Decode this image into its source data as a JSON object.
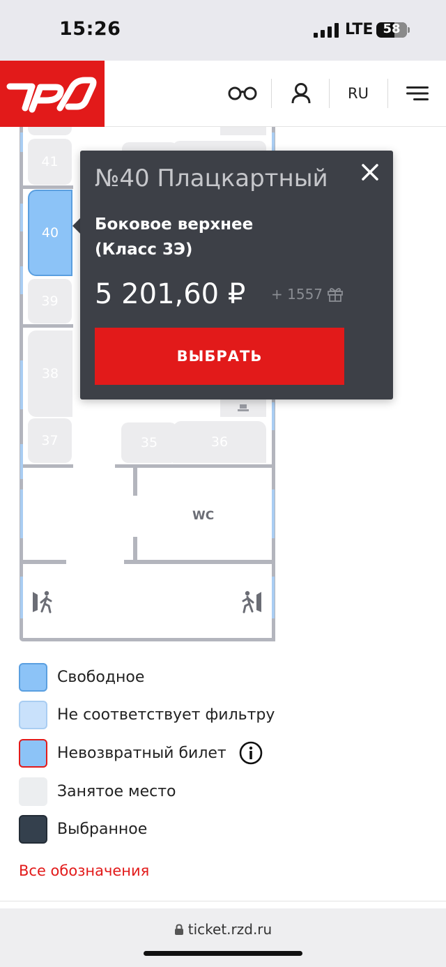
{
  "status_bar": {
    "time": "15:26",
    "network": "LTE",
    "battery": "58"
  },
  "header": {
    "logo": "РЖД",
    "language": "RU",
    "icons": [
      "glasses-icon",
      "profile-icon",
      "menu-icon"
    ]
  },
  "car_scheme": {
    "seats": [
      {
        "number": "41",
        "selected": false
      },
      {
        "number": "40",
        "selected": true
      },
      {
        "number": "39",
        "selected": false
      },
      {
        "number": "38",
        "selected": false
      },
      {
        "number": "37",
        "selected": false
      },
      {
        "number": "35",
        "selected": false
      },
      {
        "number": "36",
        "selected": false
      }
    ],
    "wc_label": "WC"
  },
  "seat_popup": {
    "title": "№40 Плацкартный",
    "description_line1": "Боковое верхнее",
    "description_line2": "(Класс 3Э)",
    "price": "5 201,60 ₽",
    "bonus": "+ 1557",
    "select_button": "ВЫБРАТЬ"
  },
  "legend": {
    "items": [
      {
        "label": "Свободное",
        "color": "#8cc3f7",
        "border": "#5a9fe0"
      },
      {
        "label": "Не соответствует фильтру",
        "color": "#c9e1fb",
        "border": "#a9cdf2"
      },
      {
        "label": "Невозвратный билет",
        "color": "#8cc3f7",
        "border": "#e21a1a"
      },
      {
        "label": "Занятое место",
        "color": "#eceef0",
        "border": "#eceef0"
      },
      {
        "label": "Выбранное",
        "color": "#34404d",
        "border": "#232c36"
      }
    ],
    "all_link": "Все обозначения"
  },
  "browser": {
    "url": "ticket.rzd.ru"
  },
  "colors": {
    "brand": "#e21a1a",
    "popup": "#3d4047"
  }
}
